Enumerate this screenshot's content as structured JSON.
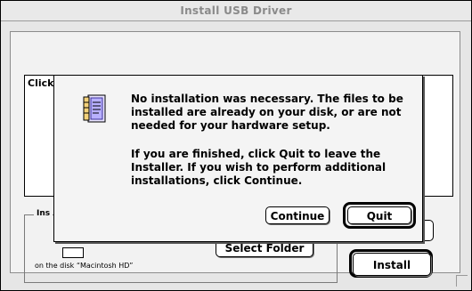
{
  "window": {
    "title": "Install USB Driver",
    "click_label": "Click",
    "group_label": "Ins",
    "disk_label": "on the disk “Macintosh HD”",
    "select_folder_label": "Select Folder",
    "install_label": "Install"
  },
  "dialog": {
    "icon": "installer-document-icon",
    "message_1": "No installation was necessary. The files to be installed are already on your disk, or are not needed for your hardware setup.",
    "message_2": "If you are finished, click Quit to leave the Installer. If you wish to perform additional installations, click Continue.",
    "continue_label": "Continue",
    "quit_label": "Quit"
  }
}
